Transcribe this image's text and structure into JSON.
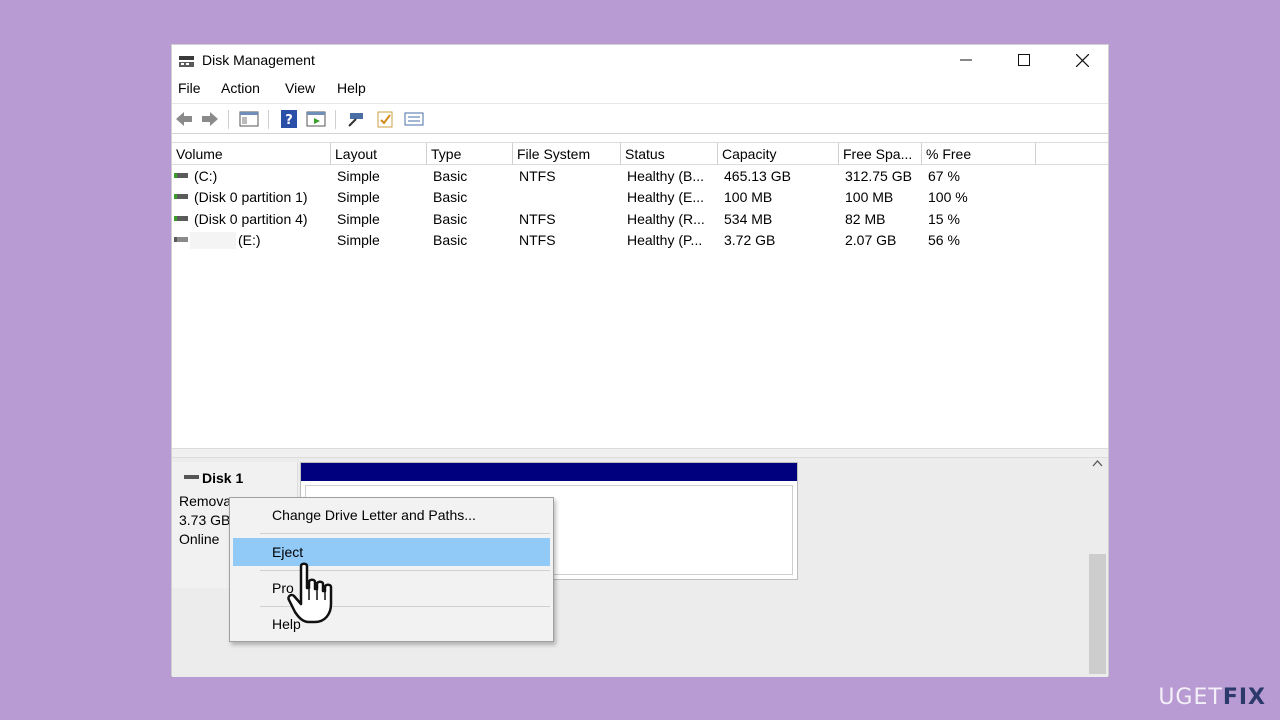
{
  "window": {
    "title": "Disk Management",
    "controls": [
      "minimize",
      "maximize",
      "close"
    ]
  },
  "menu": [
    "File",
    "Action",
    "View",
    "Help"
  ],
  "toolbar": {
    "icons": [
      "back-icon",
      "forward-icon",
      "console-icon",
      "help-icon",
      "show-hide-icon",
      "connect-icon",
      "checklist-icon",
      "properties-icon"
    ]
  },
  "volume_list": {
    "columns": [
      "Volume",
      "Layout",
      "Type",
      "File System",
      "Status",
      "Capacity",
      "Free Spa...",
      "% Free"
    ],
    "rows": [
      {
        "volume": "(C:)",
        "layout": "Simple",
        "type": "Basic",
        "fs": "NTFS",
        "status": "Healthy (B...",
        "capacity": "465.13 GB",
        "free": "312.75 GB",
        "pct": "67 %"
      },
      {
        "volume": "(Disk 0 partition 1)",
        "layout": "Simple",
        "type": "Basic",
        "fs": "",
        "status": "Healthy (E...",
        "capacity": "100 MB",
        "free": "100 MB",
        "pct": "100 %"
      },
      {
        "volume": "(Disk 0 partition 4)",
        "layout": "Simple",
        "type": "Basic",
        "fs": "NTFS",
        "status": "Healthy (R...",
        "capacity": "534 MB",
        "free": "82 MB",
        "pct": "15 %"
      },
      {
        "volume": "(E:)",
        "layout": "Simple",
        "type": "Basic",
        "fs": "NTFS",
        "status": "Healthy (P...",
        "capacity": "3.72 GB",
        "free": "2.07 GB",
        "pct": "56 %"
      }
    ]
  },
  "disk_panel": {
    "name": "Disk 1",
    "type": "Remova",
    "size": "3.73 GB",
    "state": "Online"
  },
  "context_menu": {
    "items": [
      "Change Drive Letter and Paths...",
      "Eject",
      "Properties",
      "Help"
    ],
    "highlighted": "Eject",
    "properties_visible": "Pro"
  },
  "watermark": {
    "left": "UG",
    "mid": "ET",
    "right": "FIX"
  },
  "colors": {
    "background": "#b89bd2",
    "partition_bar": "#00007f",
    "highlight": "#91c9f7"
  }
}
